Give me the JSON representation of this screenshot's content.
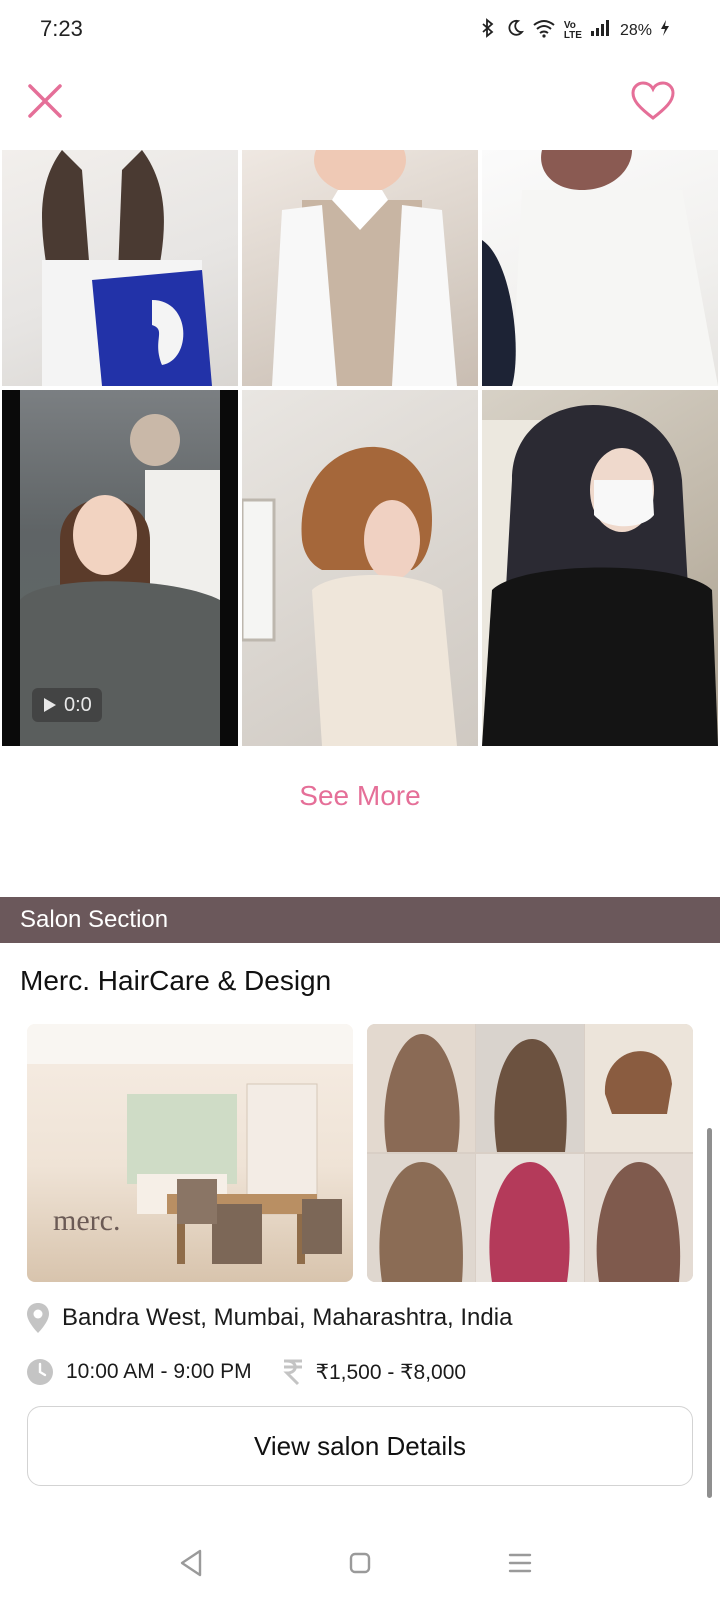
{
  "status_bar": {
    "time": "7:23",
    "battery": "28%",
    "icons": [
      "bluetooth-icon",
      "moon-icon",
      "wifi-icon",
      "volte-icon",
      "signal-icon",
      "battery-charging-icon"
    ]
  },
  "top_bar": {
    "close_icon": "close-icon",
    "favorite_icon": "heart-icon",
    "accent_color": "#e56f98"
  },
  "gallery": {
    "video_duration": "0:0",
    "tiles": [
      {
        "type": "photo",
        "description_tag": "wavy-brown-hair"
      },
      {
        "type": "photo",
        "description_tag": "short-hair-vest"
      },
      {
        "type": "photo",
        "description_tag": "white-sweater"
      },
      {
        "type": "video",
        "description_tag": "salon-selfie"
      },
      {
        "type": "photo",
        "description_tag": "bob-cut"
      },
      {
        "type": "photo",
        "description_tag": "long-dark-hair-mask"
      }
    ]
  },
  "see_more_label": "See More",
  "salon_section": {
    "header": "Salon Section",
    "header_color": "#6b585b",
    "salon_name": "Merc. HairCare & Design",
    "logo_text": "merc.",
    "address": "Bandra West, Mumbai, Maharashtra, India",
    "hours": "10:00 AM - 9:00 PM",
    "price_range": "₹1,500 - ₹8,000",
    "details_button": "View salon Details"
  },
  "nav_bar": {
    "items": [
      "back-icon",
      "home-icon",
      "menu-icon"
    ]
  }
}
